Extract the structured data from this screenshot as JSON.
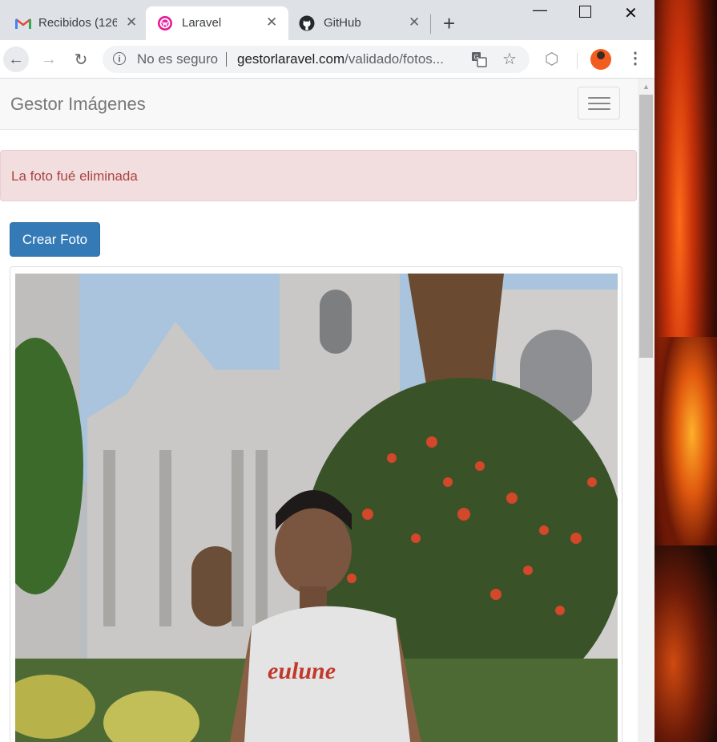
{
  "tabs": [
    {
      "label": "Recibidos (126",
      "icon": "gmail-icon",
      "active": false
    },
    {
      "label": "Laravel",
      "icon": "laravel-icon",
      "active": true
    },
    {
      "label": "GitHub",
      "icon": "github-icon",
      "active": false
    }
  ],
  "omnibox": {
    "security_label": "No es seguro",
    "url_host": "gestorlaravel.com",
    "url_path": "/validado/fotos..."
  },
  "navbar": {
    "brand": "Gestor Imágenes"
  },
  "alert": {
    "message": "La foto fué eliminada"
  },
  "actions": {
    "create_label": "Crear Foto"
  },
  "colors": {
    "primary": "#337ab7",
    "alert_bg": "#f2dede",
    "alert_text": "#a94442",
    "gmail_red": "#ea4335",
    "laravel_pink": "#e6199a"
  }
}
